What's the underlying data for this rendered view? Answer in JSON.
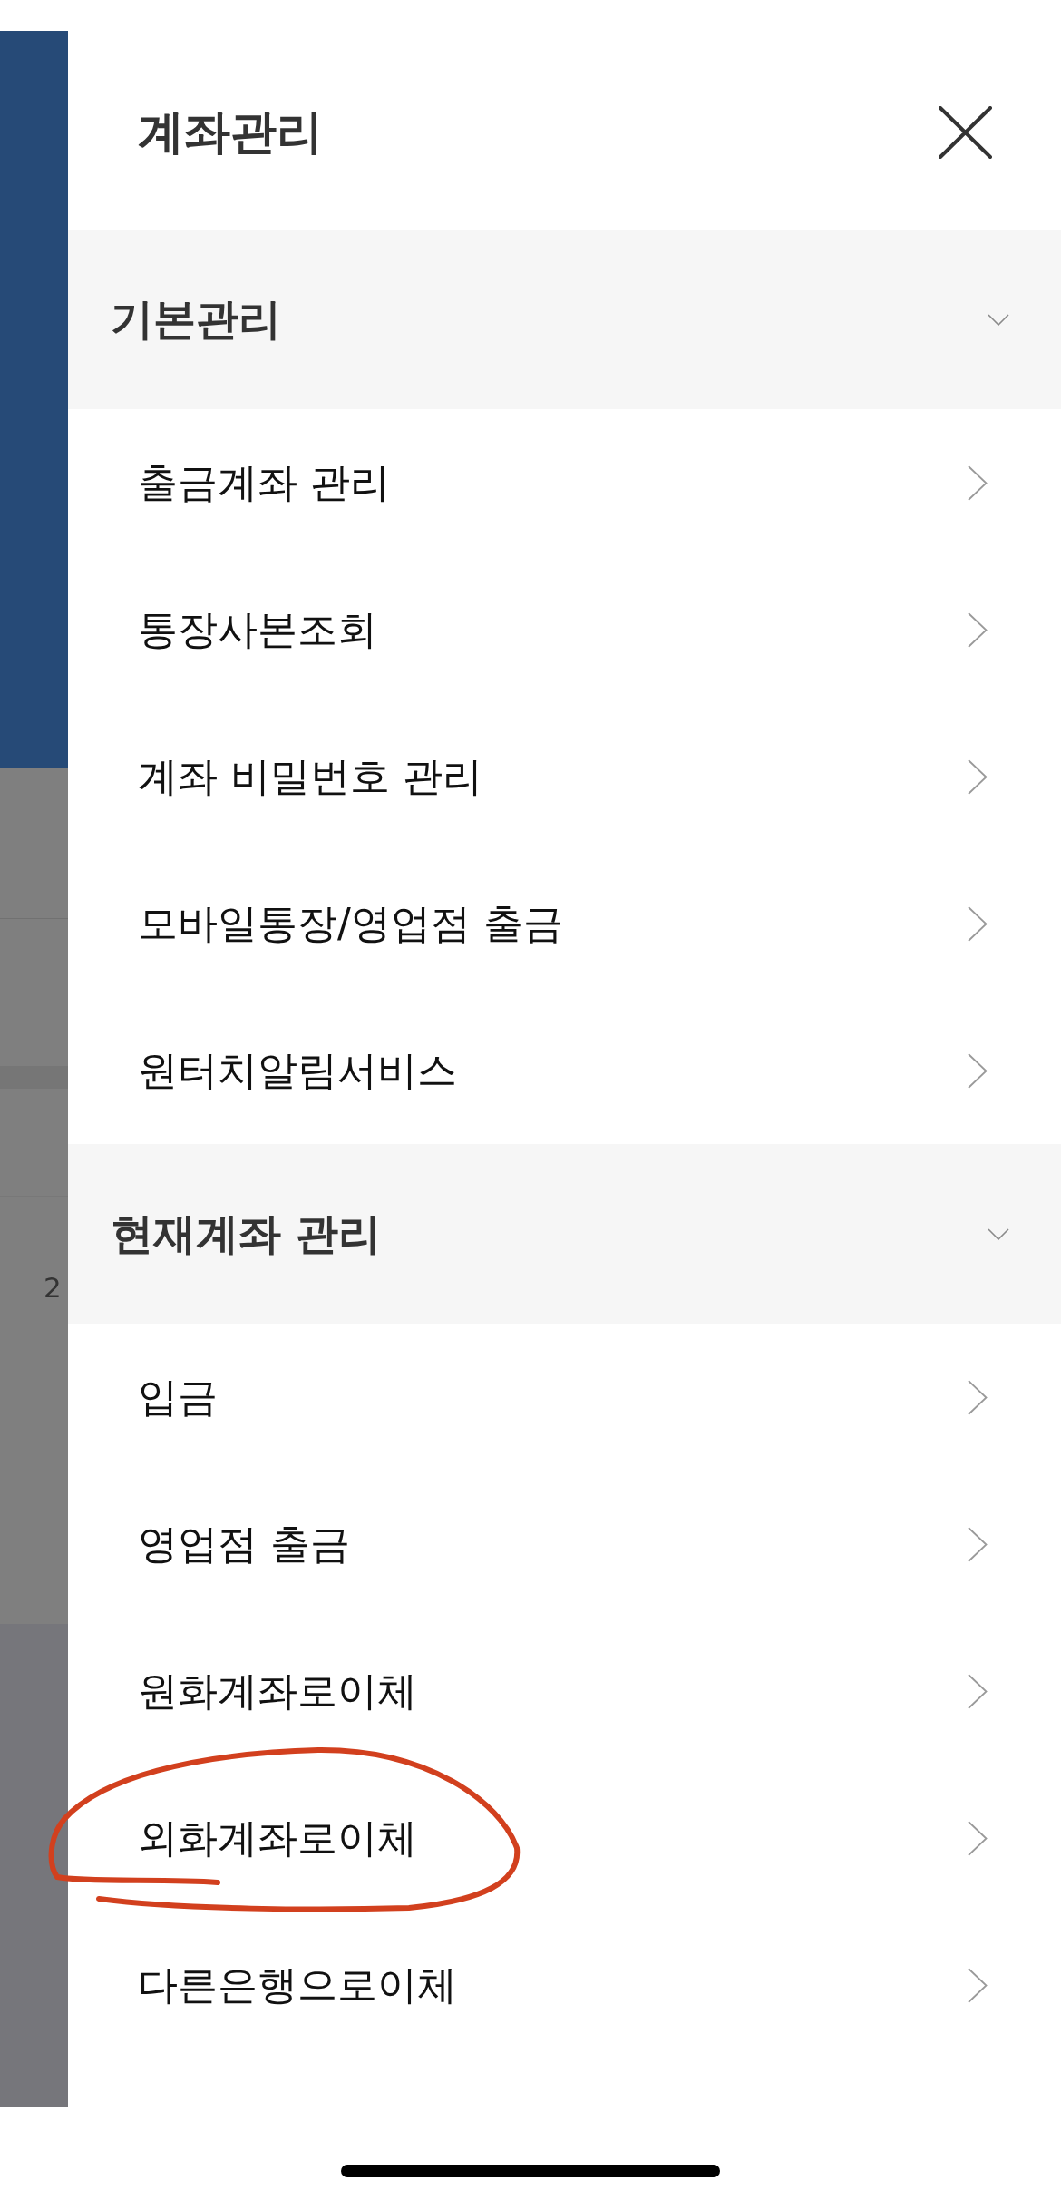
{
  "header": {
    "title": "계좌관리"
  },
  "background": {
    "fragments": [
      "2"
    ]
  },
  "sections": [
    {
      "title": "기본관리",
      "expanded": true,
      "items": [
        {
          "label": "출금계좌 관리",
          "circled": false
        },
        {
          "label": "통장사본조회",
          "circled": false
        },
        {
          "label": "계좌 비밀번호 관리",
          "circled": false
        },
        {
          "label": "모바일통장/영업점 출금",
          "circled": false
        },
        {
          "label": "원터치알림서비스",
          "circled": false
        }
      ]
    },
    {
      "title": "현재계좌 관리",
      "expanded": true,
      "items": [
        {
          "label": "입금",
          "circled": false
        },
        {
          "label": "영업점 출금",
          "circled": false
        },
        {
          "label": "원화계좌로이체",
          "circled": false
        },
        {
          "label": "외화계좌로이체",
          "circled": true
        },
        {
          "label": "다른은행으로이체",
          "circled": false
        }
      ]
    }
  ]
}
